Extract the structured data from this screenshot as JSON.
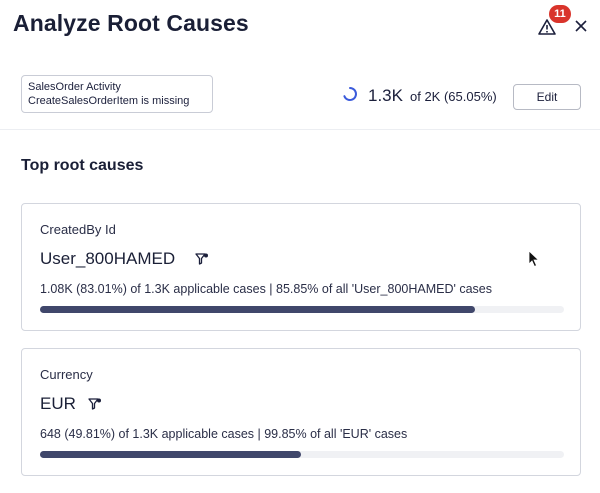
{
  "header": {
    "title": "Analyze Root Causes",
    "alert_count": "11"
  },
  "filter": {
    "line1": "SalesOrder Activity",
    "line2": "CreateSalesOrderItem is missing"
  },
  "summary": {
    "count": "1.3K",
    "of_text": "of 2K (65.05%)",
    "edit_label": "Edit"
  },
  "section": {
    "title": "Top root causes"
  },
  "causes": [
    {
      "label": "CreatedBy Id",
      "value": "User_800HAMED",
      "stat": "1.08K (83.01%) of 1.3K applicable cases | 85.85% of all 'User_800HAMED' cases",
      "progress": 0.8301
    },
    {
      "label": "Currency",
      "value": "EUR",
      "stat": "648 (49.81%) of 1.3K applicable cases | 99.85% of all 'EUR' cases",
      "progress": 0.4981
    }
  ],
  "colors": {
    "accent": "#40476b",
    "badge": "#d9342b",
    "spinner": "#3b5bdb"
  },
  "icons": [
    "alert-triangle-icon",
    "close-icon",
    "spinner-icon",
    "filter-icon",
    "mouse-cursor-icon"
  ]
}
